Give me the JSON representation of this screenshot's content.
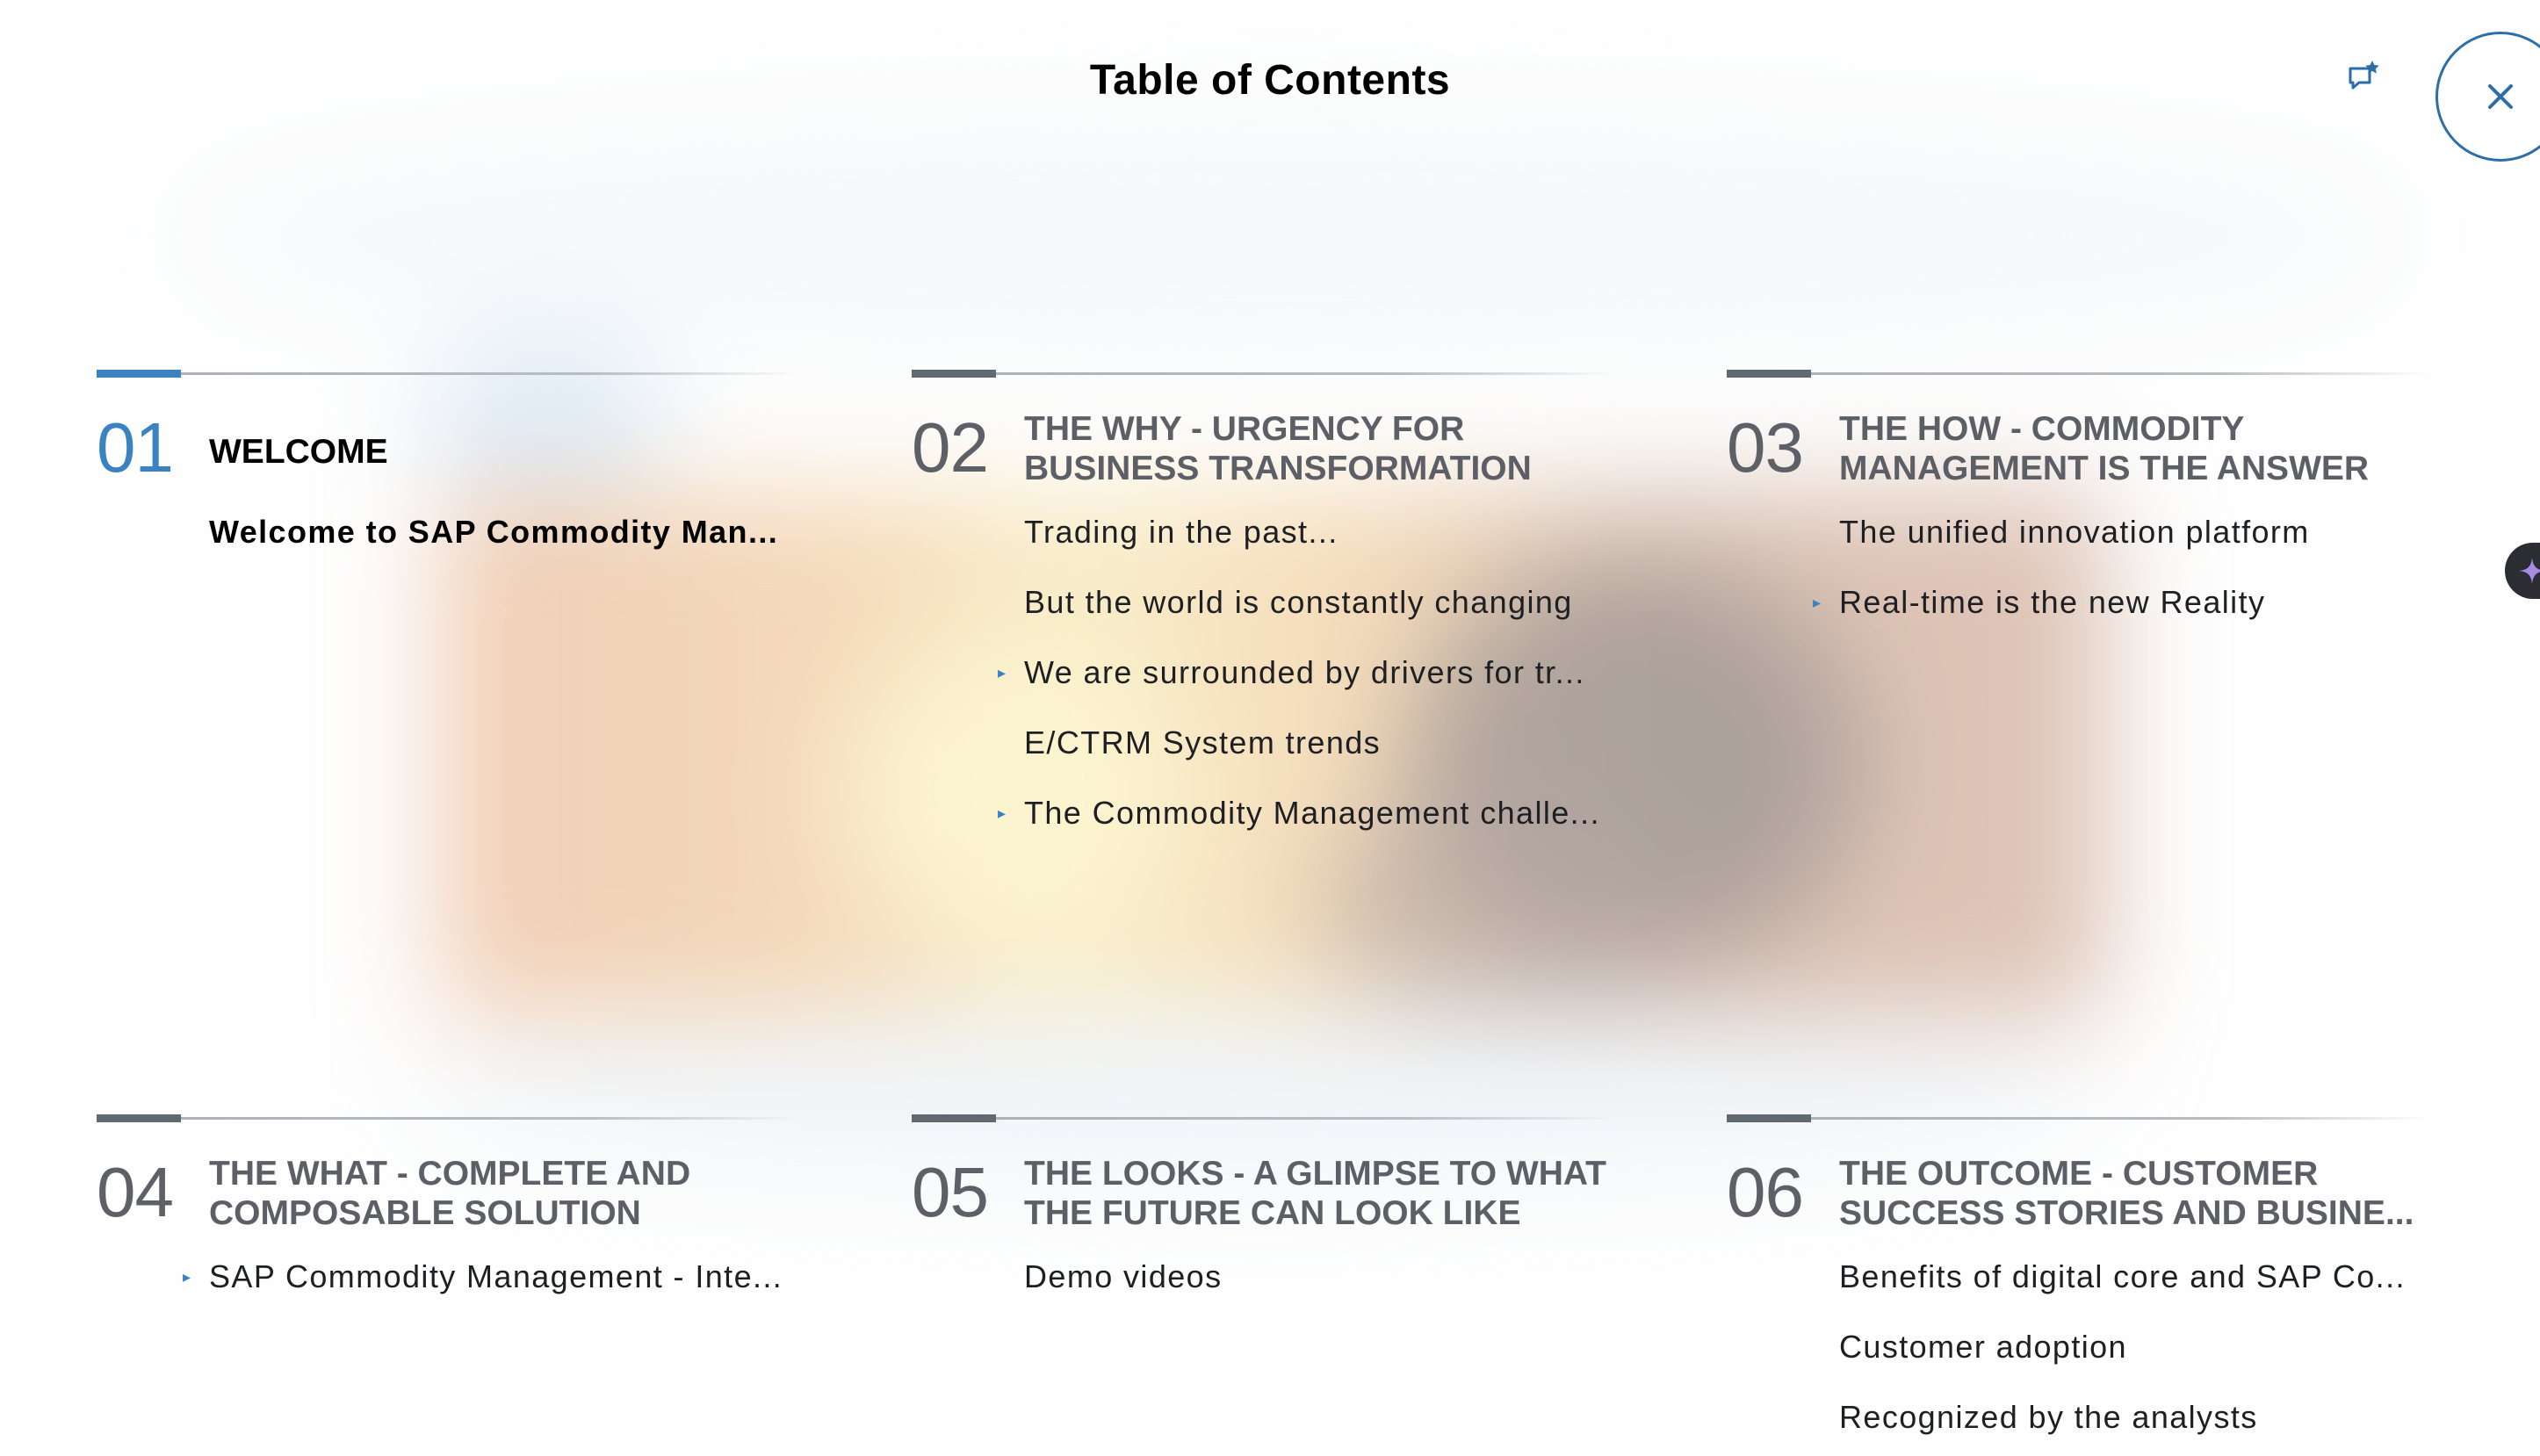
{
  "header": {
    "title": "Table of Contents",
    "feedback_icon": "feedback-icon",
    "close_icon": "close-icon"
  },
  "colors": {
    "accent": "#3a83c3",
    "muted_text": "#5c6066",
    "rule": "#a9b0b8",
    "side_tab": "#2b2d33"
  },
  "sections": [
    {
      "number": "01",
      "heading": "WELCOME",
      "active": true,
      "items": [
        {
          "label": "Welcome to SAP Commodity Man...",
          "expandable": false,
          "current": true
        }
      ]
    },
    {
      "number": "02",
      "heading": "THE WHY - URGENCY FOR BUSINESS TRANSFORMATION",
      "active": false,
      "items": [
        {
          "label": "Trading in the past...",
          "expandable": false
        },
        {
          "label": "But the world is constantly changing",
          "expandable": false
        },
        {
          "label": "We are surrounded by drivers for tr...",
          "expandable": true
        },
        {
          "label": "E/CTRM System trends",
          "expandable": false
        },
        {
          "label": "The Commodity Management challe...",
          "expandable": true
        }
      ]
    },
    {
      "number": "03",
      "heading": "THE HOW - COMMODITY MANAGEMENT IS THE ANSWER",
      "active": false,
      "items": [
        {
          "label": "The unified innovation platform",
          "expandable": false
        },
        {
          "label": "Real-time is the new Reality",
          "expandable": true
        }
      ]
    },
    {
      "number": "04",
      "heading": "THE WHAT - COMPLETE AND COMPOSABLE SOLUTION",
      "active": false,
      "items": [
        {
          "label": "SAP Commodity Management - Inte...",
          "expandable": true
        }
      ]
    },
    {
      "number": "05",
      "heading": "THE LOOKS - A GLIMPSE TO WHAT THE FUTURE CAN LOOK LIKE",
      "active": false,
      "items": [
        {
          "label": "Demo videos",
          "expandable": false
        }
      ]
    },
    {
      "number": "06",
      "heading": "THE OUTCOME - CUSTOMER SUCCESS STORIES AND BUSINE...",
      "active": false,
      "items": [
        {
          "label": "Benefits of digital core and SAP Co...",
          "expandable": false
        },
        {
          "label": "Customer adoption",
          "expandable": false
        },
        {
          "label": "Recognized by the analysts",
          "expandable": false
        }
      ]
    }
  ]
}
